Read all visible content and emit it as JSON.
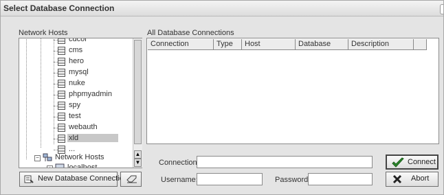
{
  "window": {
    "title": "Select Database Connection"
  },
  "hosts": {
    "label": "Network Hosts",
    "items": [
      {
        "label": "cdcol",
        "selected": false
      },
      {
        "label": "cms",
        "selected": false
      },
      {
        "label": "hero",
        "selected": false
      },
      {
        "label": "mysql",
        "selected": false
      },
      {
        "label": "nuke",
        "selected": false
      },
      {
        "label": "phpmyadmin",
        "selected": false
      },
      {
        "label": "spy",
        "selected": false
      },
      {
        "label": "test",
        "selected": false
      },
      {
        "label": "webauth",
        "selected": false
      },
      {
        "label": "xld",
        "selected": true
      },
      {
        "label": "...",
        "selected": false
      }
    ],
    "network_hosts_label": "Network Hosts",
    "localhost_label": "localhost"
  },
  "connections": {
    "label": "All Database Connections",
    "columns": [
      "Connection",
      "Type",
      "Host",
      "Database",
      "Description"
    ]
  },
  "form": {
    "connection_label": "Connection:",
    "connection_value": "",
    "username_label": "Username:",
    "username_value": "",
    "password_label": "Password:",
    "password_value": ""
  },
  "buttons": {
    "new_connection": "New Database Connection",
    "connect": "Connect",
    "abort": "Abort"
  },
  "colors": {
    "accent_green": "#2e8b2e",
    "abort_red": "#c0392b",
    "selection": "#c8c8c8"
  }
}
